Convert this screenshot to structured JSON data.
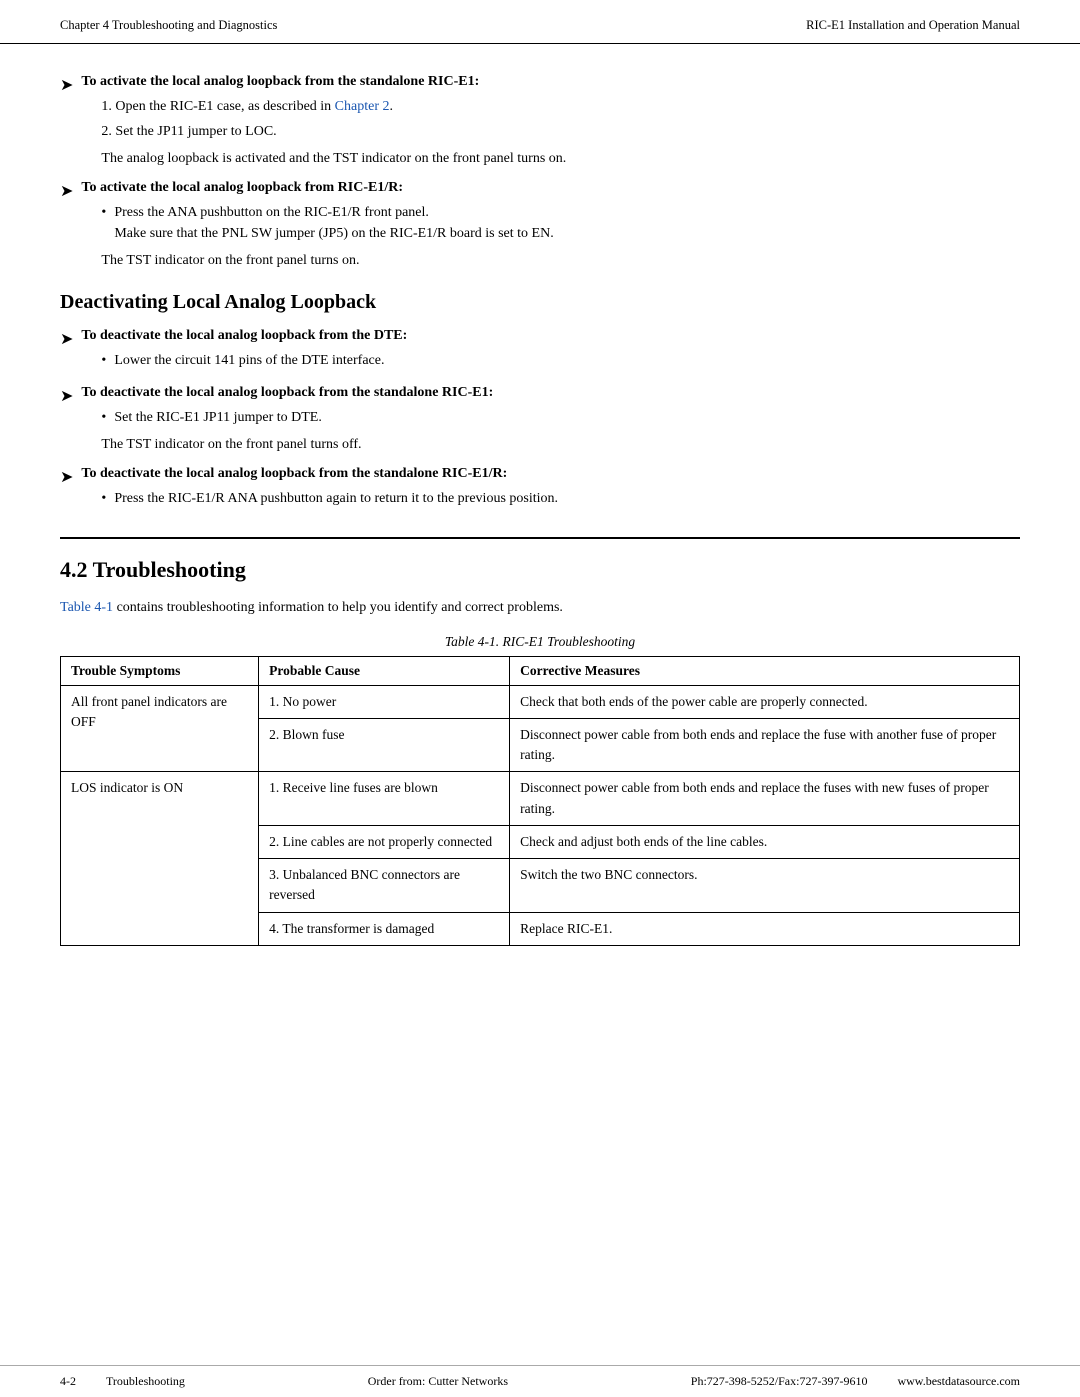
{
  "header": {
    "left": "Chapter 4  Troubleshooting and Diagnostics",
    "right": "RIC-E1 Installation and Operation Manual"
  },
  "footer": {
    "page_num": "4-2",
    "section": "Troubleshooting",
    "order": "Order from: Cutter Networks",
    "phone": "Ph:727-398-5252/Fax:727-397-9610",
    "website": "www.bestdatasource.com"
  },
  "sections": {
    "activate_standalone": {
      "heading": "To activate the local analog loopback from the standalone RIC-E1:",
      "steps": [
        "Open the RIC-E1 case, as described in ",
        "Set the JP11 jumper to LOC."
      ],
      "chapter_link": "Chapter 2",
      "indent_para": "The analog loopback is activated and the TST indicator on the front panel turns on."
    },
    "activate_ricr": {
      "heading": "To activate the local analog loopback from RIC-E1/R:",
      "bullet": "Press the ANA pushbutton on the RIC-E1/R front panel.\nMake sure that the PNL SW jumper (JP5) on the RIC-E1/R board is set to EN.",
      "indent_para": "The TST indicator on the front panel turns on."
    },
    "deactivating_heading": "Deactivating Local Analog Loopback",
    "deactivate_dte": {
      "heading": "To deactivate the local analog loopback from the DTE:",
      "bullet": "Lower the circuit 141 pins of the DTE interface."
    },
    "deactivate_standalone": {
      "heading": "To deactivate the local analog loopback from the standalone RIC-E1:",
      "bullet": "Set the RIC-E1 JP11 jumper to DTE.",
      "indent_para": "The TST indicator on the front panel turns off."
    },
    "deactivate_ricr": {
      "heading": "To deactivate the local analog loopback from the standalone RIC-E1/R:",
      "bullet": "Press the RIC-E1/R ANA pushbutton again to return it to the previous position."
    }
  },
  "section42": {
    "number": "4.2",
    "title": "Troubleshooting",
    "intro_part1": "Table 4-1",
    "intro_part2": " contains troubleshooting information to help you identify and correct problems.",
    "table_caption": "Table 4-1.  RIC-E1 Troubleshooting",
    "table_headers": [
      "Trouble Symptoms",
      "Probable Cause",
      "Corrective Measures"
    ],
    "table_rows": [
      {
        "symptom": "All front panel indicators are OFF",
        "symptom_rows": 2,
        "causes": [
          {
            "num": "1",
            "cause": "No power",
            "measure": "Check that both ends of the power cable are properly connected."
          },
          {
            "num": "2",
            "cause": "Blown fuse",
            "measure": "Disconnect power cable from both ends and replace the fuse with another fuse of proper rating."
          }
        ]
      },
      {
        "symptom": "LOS indicator is ON",
        "symptom_rows": 4,
        "causes": [
          {
            "num": "1",
            "cause": "Receive line fuses are blown",
            "measure": "Disconnect power cable from both ends and replace the fuses with new fuses of proper rating."
          },
          {
            "num": "2",
            "cause": "Line cables are not properly connected",
            "measure": "Check and adjust both ends of the line cables."
          },
          {
            "num": "3",
            "cause": "Unbalanced BNC connectors are reversed",
            "measure": "Switch the two BNC connectors."
          },
          {
            "num": "4",
            "cause": "The transformer is damaged",
            "measure": "Replace RIC-E1."
          }
        ]
      }
    ]
  }
}
